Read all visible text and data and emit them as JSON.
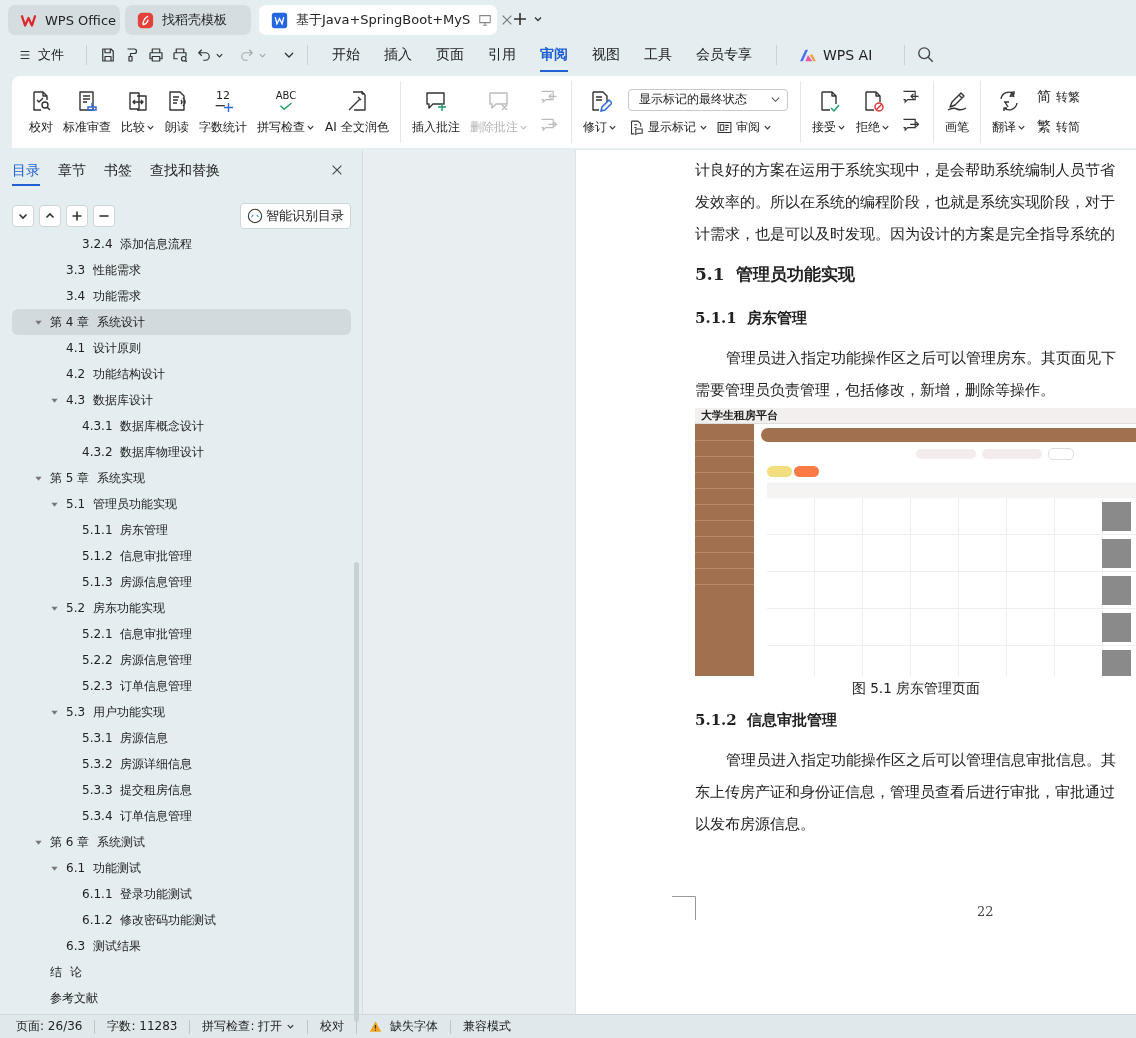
{
  "window_tabs": [
    {
      "label": "WPS Office",
      "kind": "home",
      "selected": false
    },
    {
      "label": "找稻壳模板",
      "kind": "template",
      "selected": false
    },
    {
      "label": "基于Java+SpringBoot+MyS",
      "kind": "doc",
      "selected": true
    }
  ],
  "menu": {
    "file": "文件",
    "quick_tools": [
      {
        "disabled": false
      },
      {
        "disabled": false
      },
      {
        "disabled": false
      },
      {
        "disabled": false
      },
      {
        "disabled": false
      },
      {
        "disabled": true
      }
    ],
    "tabs": [
      {
        "label": "开始",
        "selected": false
      },
      {
        "label": "插入",
        "selected": false
      },
      {
        "label": "页面",
        "selected": false
      },
      {
        "label": "引用",
        "selected": false
      },
      {
        "label": "审阅",
        "selected": true
      },
      {
        "label": "视图",
        "selected": false
      },
      {
        "label": "工具",
        "selected": false
      },
      {
        "label": "会员专享",
        "selected": false
      }
    ],
    "ai": "WPS AI"
  },
  "ribbon": {
    "groups": [
      {
        "items": [
          {
            "kind": "big",
            "label": "校对",
            "dropdown": false,
            "disabled": false
          },
          {
            "kind": "big",
            "label": "标准审查",
            "dropdown": false,
            "disabled": false
          },
          {
            "kind": "big",
            "label": "比较",
            "dropdown": true,
            "disabled": false
          },
          {
            "kind": "big",
            "label": "朗读",
            "dropdown": false,
            "disabled": false
          },
          {
            "kind": "big",
            "label": "字数统计",
            "icon_text": "12",
            "dropdown": false,
            "disabled": false
          },
          {
            "kind": "big",
            "label": "拼写检查",
            "icon_text": "ABC",
            "dropdown": true,
            "disabled": false
          },
          {
            "kind": "big",
            "label": "AI 全文润色",
            "dropdown": false,
            "disabled": false
          }
        ]
      },
      {
        "items": [
          {
            "kind": "big",
            "label": "插入批注",
            "dropdown": false,
            "disabled": false
          },
          {
            "kind": "big",
            "label": "删除批注",
            "dropdown": true,
            "disabled": true
          },
          {
            "kind": "stack",
            "buttons": [
              {
                "disabled": true
              },
              {
                "disabled": true
              }
            ]
          }
        ]
      },
      {
        "items": [
          {
            "kind": "big",
            "label": "修订",
            "dropdown": true,
            "disabled": false
          },
          {
            "kind": "markup",
            "value": "显示标记的最终状态",
            "buttons": [
              {
                "label": "显示标记",
                "dropdown": true
              },
              {
                "label": "审阅",
                "dropdown": true
              }
            ]
          }
        ]
      },
      {
        "items": [
          {
            "kind": "big",
            "label": "接受",
            "dropdown": true,
            "disabled": false
          },
          {
            "kind": "big",
            "label": "拒绝",
            "dropdown": true,
            "disabled": false
          },
          {
            "kind": "stack",
            "buttons": [
              {
                "disabled": false
              },
              {
                "disabled": false
              }
            ]
          }
        ]
      },
      {
        "items": [
          {
            "kind": "big",
            "label": "画笔",
            "dropdown": false,
            "disabled": false
          }
        ]
      },
      {
        "items": [
          {
            "kind": "big",
            "label": "翻译",
            "dropdown": true,
            "disabled": false
          },
          {
            "kind": "labels",
            "buttons": [
              {
                "label": "转繁",
                "icon_text": "简"
              },
              {
                "label": "转简",
                "icon_text": "繁"
              }
            ]
          }
        ]
      }
    ]
  },
  "nav": {
    "tabs": [
      {
        "label": "目录",
        "selected": true
      },
      {
        "label": "章节",
        "selected": false
      },
      {
        "label": "书签",
        "selected": false
      },
      {
        "label": "查找和替换",
        "selected": false
      }
    ],
    "smart_button": "智能识别目录",
    "toc": [
      {
        "children": [
          {
            "children": [
              {
                "label": "3.2.4  添加信息流程",
                "selected": false
              }
            ]
          },
          {
            "label": "3.3  性能需求",
            "selected": false
          },
          {
            "label": "3.4  功能需求",
            "selected": false
          }
        ]
      },
      {
        "label": "第 4 章  系统设计",
        "selected": true,
        "expanded": true,
        "children": [
          {
            "label": "4.1  设计原则",
            "selected": false
          },
          {
            "label": "4.2  功能结构设计",
            "selected": false
          },
          {
            "label": "4.3  数据库设计",
            "selected": false,
            "expanded": true,
            "children": [
              {
                "label": "4.3.1  数据库概念设计",
                "selected": false
              },
              {
                "label": "4.3.2  数据库物理设计",
                "selected": false
              }
            ]
          }
        ]
      },
      {
        "label": "第 5 章  系统实现",
        "selected": false,
        "expanded": true,
        "children": [
          {
            "label": "5.1  管理员功能实现",
            "selected": false,
            "expanded": true,
            "children": [
              {
                "label": "5.1.1  房东管理",
                "selected": false
              },
              {
                "label": "5.1.2  信息审批管理",
                "selected": false
              },
              {
                "label": "5.1.3  房源信息管理",
                "selected": false
              }
            ]
          },
          {
            "label": "5.2  房东功能实现",
            "selected": false,
            "expanded": true,
            "children": [
              {
                "label": "5.2.1  信息审批管理",
                "selected": false
              },
              {
                "label": "5.2.2  房源信息管理",
                "selected": false
              },
              {
                "label": "5.2.3  订单信息管理",
                "selected": false
              }
            ]
          },
          {
            "label": "5.3  用户功能实现",
            "selected": false,
            "expanded": true,
            "children": [
              {
                "label": "5.3.1  房源信息",
                "selected": false
              },
              {
                "label": "5.3.2  房源详细信息",
                "selected": false
              },
              {
                "label": "5.3.3  提交租房信息",
                "selected": false
              },
              {
                "label": "5.3.4  订单信息管理",
                "selected": false
              }
            ]
          }
        ]
      },
      {
        "label": "第 6 章  系统测试",
        "selected": false,
        "expanded": true,
        "children": [
          {
            "label": "6.1  功能测试",
            "selected": false,
            "expanded": true,
            "children": [
              {
                "label": "6.1.1  登录功能测试",
                "selected": false
              },
              {
                "label": "6.1.2  修改密码功能测试",
                "selected": false
              }
            ]
          },
          {
            "label": "6.3  测试结果",
            "selected": false
          }
        ]
      },
      {
        "label": "结  论",
        "selected": false
      },
      {
        "label": "参考文献",
        "selected": false
      }
    ]
  },
  "document": {
    "blocks": [
      {
        "kind": "para_cont",
        "lines": [
          "计良好的方案在运用于系统实现中，是会帮助系统编制人员节省",
          "发效率的。所以在系统的编程阶段，也就是系统实现阶段，对于",
          "计需求，也是可以及时发现。因为设计的方案是完全指导系统的"
        ]
      },
      {
        "kind": "h2",
        "text": "5.1  管理员功能实现"
      },
      {
        "kind": "h3",
        "text": "5.1.1  房东管理"
      },
      {
        "kind": "para",
        "lines": [
          "管理员进入指定功能操作区之后可以管理房东。其页面见下",
          "需要管理员负责管理，包括修改，新增，删除等操作。"
        ]
      },
      {
        "kind": "figure",
        "app_title": "大学生租房平台",
        "caption": "图 5.1  房东管理页面"
      },
      {
        "kind": "h3",
        "text": "5.1.2  信息审批管理"
      },
      {
        "kind": "para",
        "lines": [
          "管理员进入指定功能操作区之后可以管理信息审批信息。其",
          "东上传房产证和身份证信息，管理员查看后进行审批，审批通过",
          "以发布房源信息。"
        ]
      }
    ],
    "page_number": "22"
  },
  "status_bar": [
    {
      "kind": "text",
      "label": "页面: 26/36"
    },
    {
      "kind": "text",
      "label": "字数: 11283"
    },
    {
      "kind": "dropdown",
      "label": "拼写检查: 打开"
    },
    {
      "kind": "text",
      "label": "校对"
    },
    {
      "kind": "warning",
      "label": "缺失字体"
    },
    {
      "kind": "text",
      "label": "兼容模式"
    }
  ]
}
